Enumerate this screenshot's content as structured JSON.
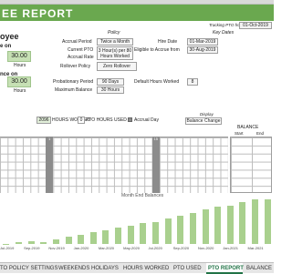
{
  "banner": {
    "title": "EE REPORT"
  },
  "tracking": {
    "label": "Tracking PTO from",
    "date": "01-Oct-2019"
  },
  "employee": {
    "heading": "oyee",
    "on1_label": "e on",
    "hours1_value": "30.00",
    "hours1_unit": "Hours",
    "on2_label": "nce on",
    "hours2_value": "30.00",
    "hours2_unit": "Hours"
  },
  "policy": {
    "header": "Policy",
    "accrual_period_label": "Accrual Period",
    "accrual_period_value": "Twice a Month",
    "current_pto_label": "Current PTO",
    "accrual_rate_label": "Accrual Rate",
    "accrual_rate_value": "3 Hour(s) per 80 Hours Worked",
    "rollover_label": "Rollover Policy",
    "rollover_value": "Zero Rollover",
    "probationary_label": "Probationary Period",
    "probationary_value": "90 Days",
    "max_balance_label": "Maximum Balance",
    "max_balance_value": "30 Hours"
  },
  "key_dates": {
    "header": "Key Dates",
    "hire_date_label": "Hire Date",
    "hire_date_value": "01-Mar-2019",
    "eligible_label": "Eligible to Accrue from",
    "eligible_value": "30-Aug-2019",
    "default_hours_label": "Default Hours Worked",
    "default_hours_value": "8"
  },
  "summary": {
    "hours_worked_value": "2096",
    "hours_worked_label": "HOURS WORKED",
    "pto_used_value": "0",
    "pto_used_label": "PTO HOURS USED",
    "accrual_day_label": "Accrual Day",
    "display_label": "Display",
    "display_value": "Balance Change"
  },
  "balance": {
    "header": "BALANCE",
    "start": "Start",
    "end": "End"
  },
  "grid": {
    "highlight_numbers": [
      "1",
      "15"
    ]
  },
  "chart_data": {
    "type": "bar",
    "title": "Month End Balances",
    "categories": [
      "Jul-2019",
      "Aug-2019",
      "Sep-2019",
      "Oct-2019",
      "Nov-2019",
      "Dec-2019",
      "Jan-2020",
      "Feb-2020",
      "Mar-2020",
      "Apr-2020",
      "May-2020",
      "Jun-2020",
      "Jul-2020",
      "Aug-2020",
      "Sep-2020",
      "Oct-2020",
      "Nov-2020",
      "Dec-2020",
      "Jan-2021",
      "Feb-2021",
      "Mar-2021",
      "Apr-2021"
    ],
    "visible_labels": [
      "Jul-2019",
      "Sep-2019",
      "Nov-2019",
      "Jan-2020",
      "Mar-2020",
      "May-2020",
      "Jul-2020",
      "Sep-2020",
      "Nov-2020",
      "Jan-2021",
      "Mar-2021"
    ],
    "label_prefix": "Jul",
    "values": [
      0,
      1,
      2,
      1.5,
      3,
      5,
      6,
      8,
      9,
      11,
      12,
      14,
      15,
      17,
      19,
      21,
      23,
      25,
      26,
      28,
      30,
      30
    ],
    "ylim": [
      0,
      30
    ]
  },
  "tabs": [
    "TO POLICY SETTINGS",
    "WEEKENDS HOLIDAYS",
    "HOURS WORKED",
    "PTO USED",
    "PTO REPORT",
    "BALANCE"
  ],
  "active_tab": "PTO REPORT",
  "colors": {
    "banner": "#6aa84f",
    "bar": "#a9d08e",
    "highlight": "#8c8c8c",
    "tab_active": "#217346"
  }
}
